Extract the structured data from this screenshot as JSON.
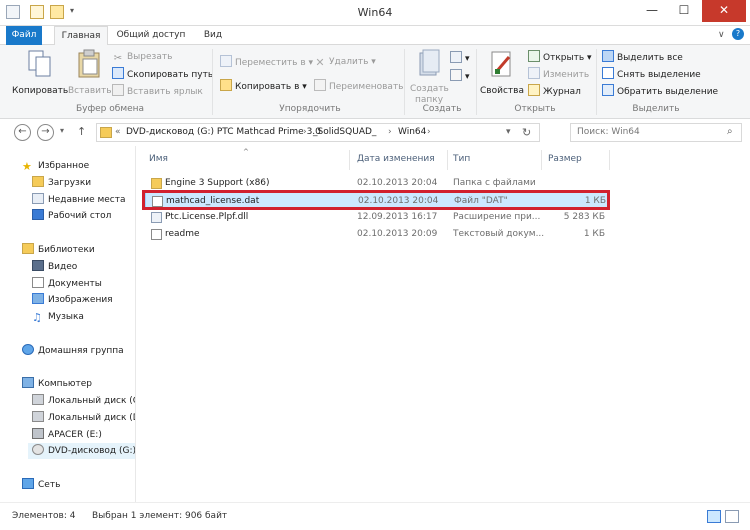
{
  "window": {
    "title": "Win64",
    "minimize_glyph": "—",
    "maximize_glyph": "☐",
    "close_glyph": "✕"
  },
  "tabs": [
    {
      "label": "Файл"
    },
    {
      "label": "Главная"
    },
    {
      "label": "Общий доступ"
    },
    {
      "label": "Вид"
    }
  ],
  "ribbon": {
    "clipboard": {
      "copy": "Копировать",
      "paste": "Вставить",
      "cut": "Вырезать",
      "copy_path": "Скопировать путь",
      "paste_shortcut": "Вставить ярлык",
      "group_label": "Буфер обмена"
    },
    "organize": {
      "move_to": "Переместить в",
      "copy_to": "Копировать в",
      "delete": "Удалить",
      "rename": "Переименовать",
      "group_label": "Упорядочить"
    },
    "create": {
      "new_folder_line1": "Создать",
      "new_folder_line2": "папку",
      "group_label": "Создать"
    },
    "open": {
      "properties": "Свойства",
      "open": "Открыть",
      "edit": "Изменить",
      "history": "Журнал",
      "group_label": "Открыть"
    },
    "select": {
      "select_all": "Выделить все",
      "select_none": "Снять выделение",
      "invert": "Обратить выделение",
      "group_label": "Выделить"
    }
  },
  "address": {
    "chevron": "«",
    "segments": [
      "DVD-дисковод (G:) PTC Mathcad Prime 3.0",
      "_SolidSQUAD_",
      "Win64"
    ],
    "search_placeholder": "Поиск: Win64"
  },
  "nav": {
    "favorites": "Избранное",
    "downloads": "Загрузки",
    "recent": "Недавние места",
    "desktop": "Рабочий стол",
    "libraries": "Библиотеки",
    "video": "Видео",
    "documents": "Документы",
    "images": "Изображения",
    "music": "Музыка",
    "homegroup": "Домашняя группа",
    "computer": "Компьютер",
    "local_c": "Локальный диск (C",
    "local_d": "Локальный диск (D",
    "apacer": "APACER (E:)",
    "dvd": "DVD-дисковод (G:) I",
    "network": "Сеть"
  },
  "columns": {
    "name": "Имя",
    "date": "Дата изменения",
    "type": "Тип",
    "size": "Размер"
  },
  "files": [
    {
      "name": "Engine 3 Support (x86)",
      "date": "02.10.2013 20:04",
      "type": "Папка с файлами",
      "size": "",
      "icon": "folder-icon"
    },
    {
      "name": "mathcad_license.dat",
      "date": "02.10.2013 20:04",
      "type": "Файл \"DAT\"",
      "size": "1 КБ",
      "icon": "file-icon"
    },
    {
      "name": "Ptc.License.Plpf.dll",
      "date": "12.09.2013 16:17",
      "type": "Расширение при...",
      "size": "5 283 КБ",
      "icon": "dll-file-icon"
    },
    {
      "name": "readme",
      "date": "02.10.2013 20:09",
      "type": "Текстовый докум...",
      "size": "1 КБ",
      "icon": "text-file-icon"
    }
  ],
  "status": {
    "count": "Элементов: 4",
    "selection": "Выбран 1 элемент: 906 байт"
  },
  "colors": {
    "accent": "#1979ca",
    "selection": "#cce8ff",
    "highlight": "#d1202e"
  }
}
